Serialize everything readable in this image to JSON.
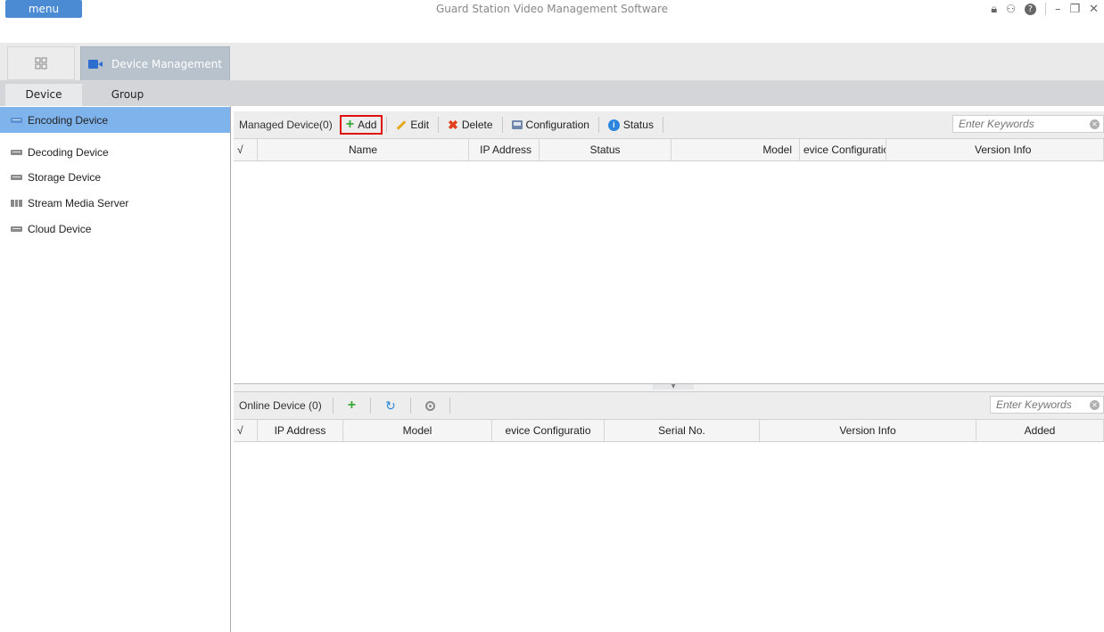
{
  "window": {
    "menu_label": "menu",
    "title": "Guard Station Video Management Software",
    "icons": [
      "lock-icon",
      "users-icon",
      "help-icon",
      "minimize-icon",
      "restore-icon",
      "close-icon"
    ]
  },
  "tabs": {
    "home_icon": "grid-icon",
    "device_management": "Device Management"
  },
  "subtabs": [
    "Device",
    "Group"
  ],
  "sidebar": {
    "items": [
      {
        "label": "Encoding Device",
        "icon": "device-icon",
        "active": true
      },
      {
        "label": "Decoding Device",
        "icon": "device-icon"
      },
      {
        "label": "Storage Device",
        "icon": "device-icon"
      },
      {
        "label": "Stream Media Server",
        "icon": "server-icon"
      },
      {
        "label": "Cloud Device",
        "icon": "device-icon"
      }
    ]
  },
  "managed": {
    "label": "Managed Device(0)",
    "buttons": {
      "add": "Add",
      "edit": "Edit",
      "delete": "Delete",
      "configuration": "Configuration",
      "status": "Status"
    },
    "search_placeholder": "Enter Keywords",
    "columns": [
      "√",
      "Name",
      "IP Address",
      "Status",
      "Model",
      "evice Configuratio",
      "Version Info"
    ]
  },
  "online": {
    "label": "Online Device (0)",
    "search_placeholder": "Enter Keywords",
    "columns": [
      "√",
      "IP Address",
      "Model",
      "evice Configuratio",
      "Serial No.",
      "Version Info",
      "Added"
    ]
  },
  "colors": {
    "accent": "#4a8bd4",
    "active_row": "#7fb3ec",
    "add_highlight": "#e01010"
  }
}
